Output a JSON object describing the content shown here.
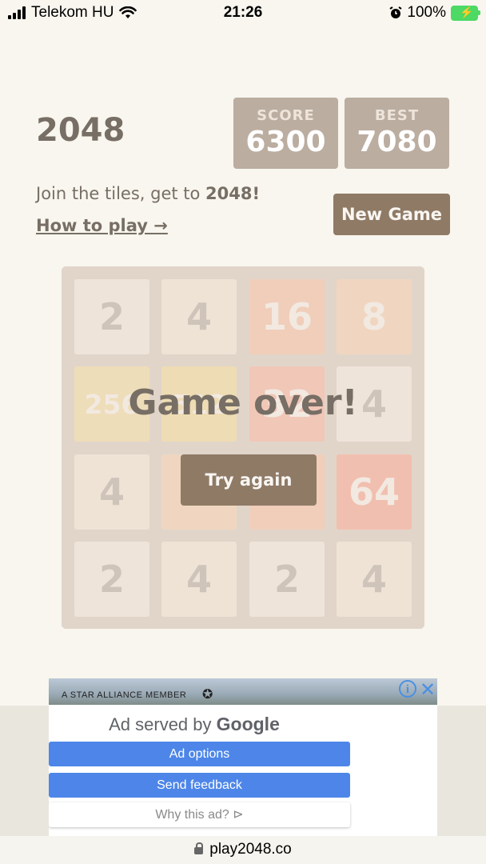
{
  "status_bar": {
    "carrier": "Telekom HU",
    "time": "21:26",
    "battery": "100%"
  },
  "header": {
    "title": "2048",
    "score_label": "SCORE",
    "score": "6300",
    "best_label": "BEST",
    "best": "7080"
  },
  "intro": {
    "text": "Join the tiles, get to ",
    "goal": "2048!",
    "how_to": "How to play →"
  },
  "new_game_label": "New Game",
  "board": {
    "tiles": [
      [
        "2",
        "4",
        "16",
        "8"
      ],
      [
        "256",
        "512",
        "32",
        "4"
      ],
      [
        "4",
        "",
        "",
        "64"
      ],
      [
        "2",
        "4",
        "2",
        "4"
      ]
    ]
  },
  "game_over": {
    "message": "Game over!",
    "try_again": "Try again"
  },
  "ad": {
    "banner_text": "A STAR ALLIANCE MEMBER",
    "served_by": "Ad served by",
    "google": "Google",
    "ad_options": "Ad options",
    "send_feedback": "Send feedback",
    "why_this_ad": "Why this ad? ⊳"
  },
  "url": "play2048.co",
  "colors": {
    "background": "#f8f6ee",
    "board": "#bbada0",
    "button": "#8f7a66",
    "text": "#776e65"
  }
}
